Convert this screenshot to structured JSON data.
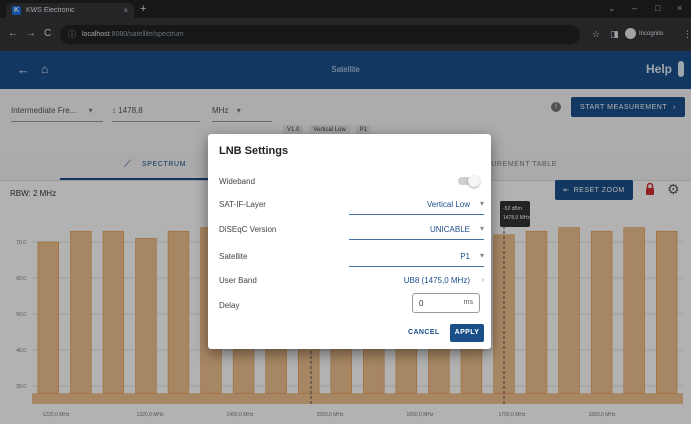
{
  "browser": {
    "tab_title": "KWS Electronic",
    "tab_close": "×",
    "new_tab": "+",
    "url_host": "localhost",
    "url_path": ":8080/satellite/spectrum",
    "minimize": "–",
    "maximize": "□",
    "close": "×",
    "incognito_label": "Incognito"
  },
  "appbar": {
    "title": "Satellite",
    "help": "Help"
  },
  "settings": {
    "input_type": "Intermediate Fre...",
    "frequency": "1478,8",
    "unit": "MHz",
    "start_button": "START MEASUREMENT",
    "chips": [
      "V1.0",
      "Vertical Low",
      "P1"
    ]
  },
  "tabs": {
    "spectrum": "SPECTRUM",
    "measurement_table": "SUREMENT TABLE"
  },
  "toolbar": {
    "rbw": "RBW: 2 MHz",
    "reset_zoom": "RESET ZOOM"
  },
  "chart_data": {
    "type": "area",
    "y_ticks": [
      "70.0",
      "60.0",
      "50.0",
      "40.0",
      "30.0"
    ],
    "x_ticks": [
      "1220,0 MHz",
      "1320,0 MHz",
      "1450,0 MHz",
      "1550,0 MHz",
      "1650,0 MHz",
      "1750,0 MHz",
      "1850,0 MHz"
    ],
    "ylim": [
      25,
      80
    ],
    "marker_label": [
      "-52 dBm",
      "1478,0 MHz"
    ],
    "band_tops": [
      70,
      73,
      73,
      71,
      73,
      74,
      74,
      72,
      73,
      74,
      72,
      73,
      74,
      74,
      72,
      73,
      74,
      73,
      74,
      73
    ],
    "noise_floor": 28,
    "fill_color": "#f0c08e",
    "edge_color": "#e69a4c"
  },
  "modal": {
    "title": "LNB Settings",
    "wideband_label": "Wideband",
    "sat_if_layer_label": "SAT-IF-Layer",
    "sat_if_layer_value": "Vertical Low",
    "diseqc_label": "DiSEqC Version",
    "diseqc_value": "UNICABLE",
    "satellite_label": "Satellite",
    "satellite_value": "P1",
    "user_band_label": "User Band",
    "user_band_value": "UB8 (1475,0 MHz)",
    "delay_label": "Delay",
    "delay_value": "0",
    "delay_unit": "ms",
    "cancel": "CANCEL",
    "apply": "APPLY"
  },
  "colors": {
    "primary": "#1b4f8a",
    "lock": "#d32f2f"
  }
}
